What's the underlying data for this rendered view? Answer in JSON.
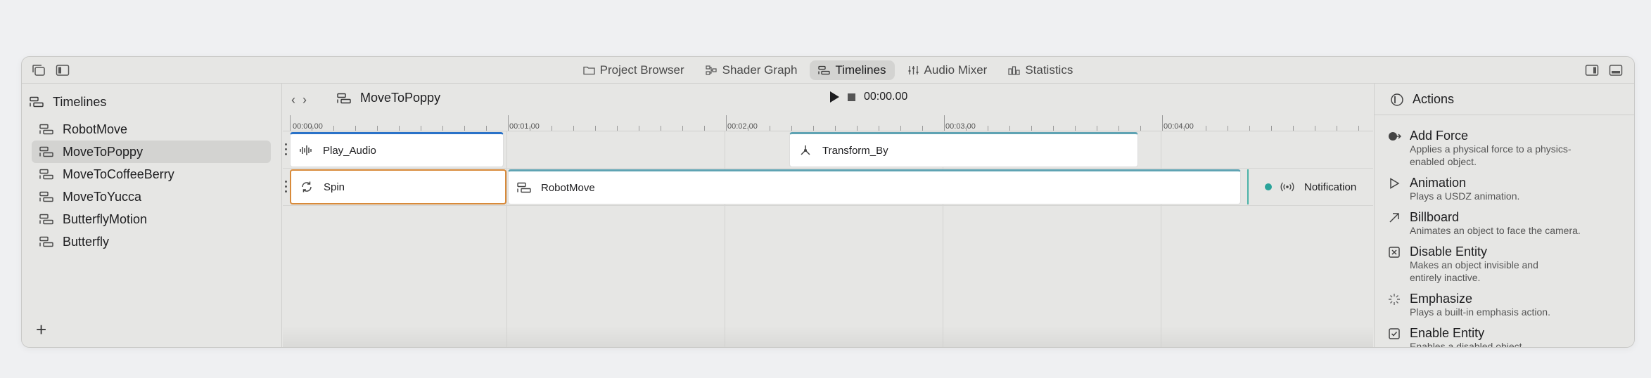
{
  "toolbar": {
    "tabs": [
      {
        "label": "Project Browser",
        "icon": "folder-icon"
      },
      {
        "label": "Shader Graph",
        "icon": "graph-icon"
      },
      {
        "label": "Timelines",
        "icon": "timeline-icon"
      },
      {
        "label": "Audio Mixer",
        "icon": "mixer-icon"
      },
      {
        "label": "Statistics",
        "icon": "stats-icon"
      }
    ],
    "active_tab": "Timelines"
  },
  "sidebar": {
    "title": "Timelines",
    "items": [
      {
        "label": "RobotMove"
      },
      {
        "label": "MoveToPoppy",
        "selected": true
      },
      {
        "label": "MoveToCoffeeBerry"
      },
      {
        "label": "MoveToYucca"
      },
      {
        "label": "ButterflyMotion"
      },
      {
        "label": "Butterfly"
      }
    ],
    "add_label": "+"
  },
  "timeline": {
    "title": "MoveToPoppy",
    "time": "00:00.00",
    "ruler_labels": [
      "00:00.00",
      "00:01.00",
      "00:02.00",
      "00:03.00",
      "00:04.00"
    ],
    "track1": {
      "clip_play_audio": "Play_Audio",
      "clip_transform": "Transform_By"
    },
    "track2": {
      "clip_spin": "Spin",
      "clip_robotmove": "RobotMove",
      "notification": "Notification"
    },
    "colors": {
      "selected": "#d88a3a",
      "accent_blue": "#2a72c8",
      "accent_teal": "#5fa3b3",
      "notification": "#2aa39a"
    }
  },
  "inspector": {
    "title": "Actions",
    "actions": [
      {
        "title": "Add Force",
        "desc1": "Applies a physical force to a physics-",
        "desc2": "enabled object.",
        "icon": "force-icon"
      },
      {
        "title": "Animation",
        "desc1": "Plays a USDZ animation.",
        "icon": "play-outline-icon"
      },
      {
        "title": "Billboard",
        "desc1": "Animates an object to face the camera.",
        "icon": "arrow-up-right-icon"
      },
      {
        "title": "Disable Entity",
        "desc1": "Makes an object invisible and",
        "desc2": "entirely inactive.",
        "icon": "x-square-icon"
      },
      {
        "title": "Emphasize",
        "desc1": "Plays a built-in emphasis action.",
        "icon": "sparkle-icon"
      },
      {
        "title": "Enable Entity",
        "desc1": "Enables a disabled object.",
        "icon": "check-square-icon"
      }
    ]
  }
}
